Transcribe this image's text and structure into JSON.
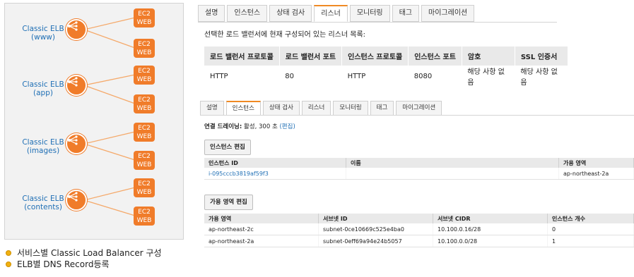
{
  "diagram": {
    "elbs": [
      {
        "label_line1": "Classic ELB",
        "label_line2": "(www)"
      },
      {
        "label_line1": "Classic ELB",
        "label_line2": "(app)"
      },
      {
        "label_line1": "Classic ELB",
        "label_line2": "(images)"
      },
      {
        "label_line1": "Classic ELB",
        "label_line2": "(contents)"
      }
    ],
    "ec2_line1": "EC2",
    "ec2_line2": "WEB",
    "accent_color": "#f07c2a",
    "label_color": "#1f6fb5"
  },
  "notes": [
    "서비스별 Classic Load Balancer 구성",
    "ELB별 DNS Record등록"
  ],
  "top_console": {
    "tabs": [
      "설명",
      "인스턴스",
      "상태 검사",
      "리스너",
      "모니터링",
      "태그",
      "마이그레이션"
    ],
    "active_tab": "리스너",
    "description": "선택한 로드 밸런서에 현재 구성되어 있는 리스너 목록:",
    "table": {
      "headers": [
        "로드 밸런서 프로토콜",
        "로드 밸런서 포트",
        "인스턴스 프로토콜",
        "인스턴스 포트",
        "암호",
        "SSL 인증서"
      ],
      "rows": [
        [
          "HTTP",
          "80",
          "HTTP",
          "8080",
          "해당 사항 없음",
          "해당 사항 없음"
        ]
      ]
    }
  },
  "bottom_console": {
    "tabs": [
      "설명",
      "인스턴스",
      "상태 검사",
      "리스너",
      "모니터링",
      "태그",
      "마이그레이션"
    ],
    "active_tab": "인스턴스",
    "drain_label": "연결 드레이닝:",
    "drain_value": "활성, 300 초",
    "drain_edit": "(편집)",
    "edit_instances_button": "인스턴스 편집",
    "instances_table": {
      "headers": [
        "인스턴스 ID",
        "이름",
        "가용 영역"
      ],
      "rows": [
        [
          "i-095cccb3819af59f3",
          "",
          "ap-northeast-2a"
        ]
      ]
    },
    "edit_az_button": "가용 영역 편집",
    "az_table": {
      "headers": [
        "가용 영역",
        "서브넷 ID",
        "서브넷 CIDR",
        "인스턴스 개수"
      ],
      "rows": [
        [
          "ap-northeast-2c",
          "subnet-0ce10669c525e4ba0",
          "10.100.0.16/28",
          "0"
        ],
        [
          "ap-northeast-2a",
          "subnet-0eff69a94e24b5057",
          "10.100.0.0/28",
          "1"
        ]
      ]
    }
  }
}
